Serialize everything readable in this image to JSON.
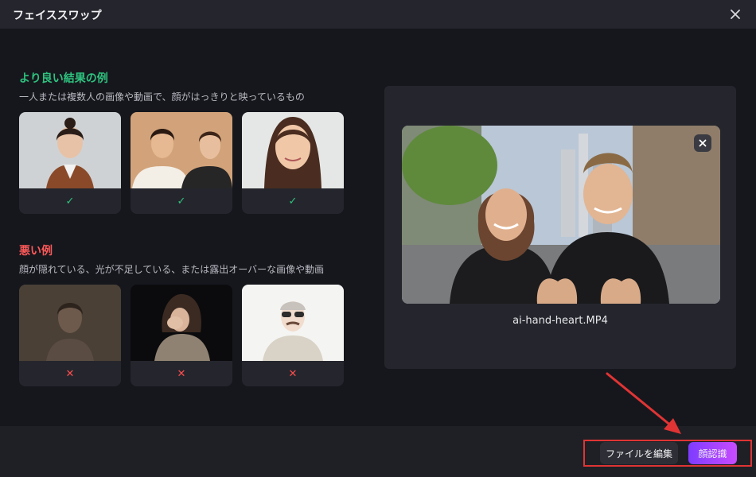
{
  "window": {
    "title": "フェイススワップ"
  },
  "good": {
    "heading": "より良い結果の例",
    "description": "一人または複数人の画像や動画で、顔がはっきりと映っているもの",
    "mark": "✓"
  },
  "bad": {
    "heading": "悪い例",
    "description": "顔が隠れている、光が不足している、または露出オーバーな画像や動画",
    "mark": "✕"
  },
  "preview": {
    "filename": "ai-hand-heart.MP4"
  },
  "footer": {
    "edit_label": "ファイルを編集",
    "face_label": "顔認識"
  },
  "colors": {
    "accent_good": "#2ec27e",
    "accent_bad": "#ff4d4d",
    "primary_gradient_start": "#7d3cff",
    "primary_gradient_end": "#c94bff",
    "highlight": "#e03434"
  },
  "icons": {
    "close": "close-icon",
    "check": "check-icon",
    "cross": "cross-icon",
    "arrow": "pointer-arrow"
  }
}
